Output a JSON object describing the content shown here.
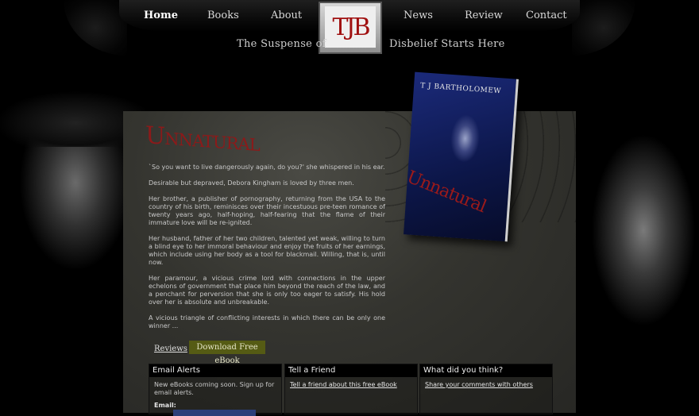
{
  "nav": {
    "home": "Home",
    "books": "Books",
    "about": "About",
    "news": "News",
    "review": "Review",
    "contact": "Contact"
  },
  "logo": {
    "text": "TJB"
  },
  "tagline": {
    "left": "The Suspense of",
    "right": "Disbelief Starts Here"
  },
  "book": {
    "title": "Unnatural",
    "cover_author": "T J BARTHOLOMEW",
    "cover_title": "Unnatural",
    "synopsis": [
      "`So you want to live dangerously again, do you?' she whispered in his ear.",
      "Desirable but depraved, Debora Kingham is loved by three men.",
      "Her brother, a publisher of pornography, returning from the USA to the country of his birth, reminisces over their incestuous pre-teen romance of twenty years ago, half-hoping, half-fearing that the flame of their immature love will be re-ignited.",
      "Her husband, father of her two children, talented yet weak, willing to turn a blind eye to her immoral behaviour and enjoy the fruits of her earnings, which include using her body as a tool for blackmail. Willing, that is, until now.",
      "Her paramour, a vicious crime lord with connections in the upper echelons of government that place him beyond the reach of the law, and a penchant for perversion that she is only too eager to satisfy. His hold over her is absolute and unbreakable.",
      "A vicious triangle of conflicting interests in which there can be only one winner ..."
    ]
  },
  "actions": {
    "reviews": "Reviews",
    "download": "Download Free eBook"
  },
  "boxes": {
    "alerts": {
      "title": "Email Alerts",
      "text": "New eBooks coming soon. Sign up for email alerts.",
      "email_label": "Email:"
    },
    "friend": {
      "title": "Tell a Friend",
      "link": "Tell a friend about this free eBook"
    },
    "think": {
      "title": "What did you think?",
      "link": "Share your comments with others"
    }
  },
  "colors": {
    "accent_red": "#8b1a1a",
    "button_olive": "#555b14",
    "input_blue": "#2b3f7a"
  }
}
